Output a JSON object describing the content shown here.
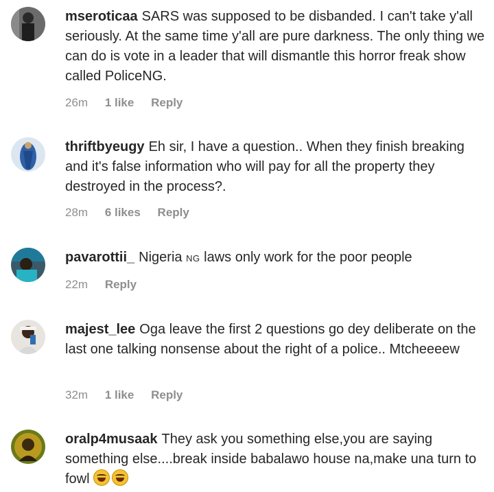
{
  "comments": [
    {
      "username": "mseroticaa",
      "text": "SARS was supposed to be disbanded. I can't take y'all seriously. At the same time y'all are pure darkness. The only thing we can do is vote in a leader that will dismantle this horror freak show called PoliceNG.",
      "time": "26m",
      "likes": "1 like",
      "reply": "Reply"
    },
    {
      "username": "thriftbyeugy",
      "text": "Eh sir, I have a question.. When they finish breaking and it's false information who will pay for all the property they destroyed in the process?.",
      "time": "28m",
      "likes": "6 likes",
      "reply": "Reply"
    },
    {
      "username": "pavarottii_",
      "text_before": "Nigeria",
      "flag": "NG",
      "text_after": "laws only work for the poor people",
      "time": "22m",
      "reply": "Reply"
    },
    {
      "username": "majest_lee",
      "text": "Oga leave the first 2 questions go dey deliberate on the last one talking nonsense about the right of a police.. Mtcheeeew",
      "time": "32m",
      "likes": "1 like",
      "reply": "Reply"
    },
    {
      "username": "oralp4musaak",
      "text": "They ask you something else,you are saying something else....break inside babalawo house na,make una turn to fowl",
      "emojis": [
        "face-with-tears-of-joy-icon",
        "face-with-tears-of-joy-icon"
      ]
    }
  ],
  "colors": {
    "text": "#262626",
    "meta": "#8e8e8e",
    "background": "#ffffff"
  }
}
